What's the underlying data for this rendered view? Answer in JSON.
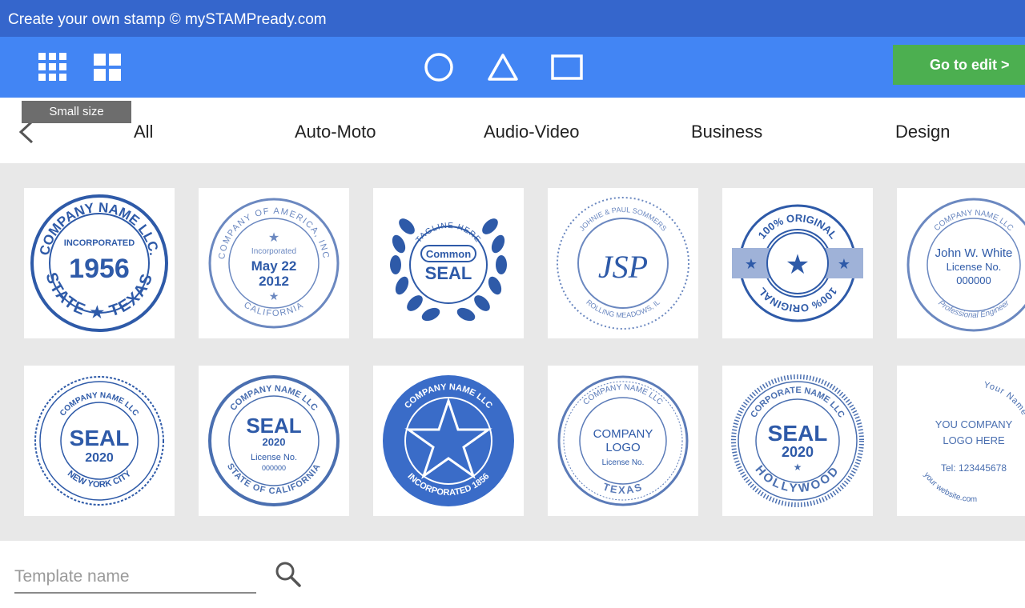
{
  "app": {
    "title": "Create your own stamp © mySTAMPready.com"
  },
  "toolbar": {
    "icons": [
      "large-grid-icon",
      "small-grid-icon",
      "circle-shape-icon",
      "triangle-shape-icon",
      "rectangle-shape-icon"
    ],
    "edit_label": "Go to edit  >"
  },
  "tooltip": {
    "text": "Small size"
  },
  "categories": {
    "all": "All",
    "auto_moto": "Auto-Moto",
    "audio_video": "Audio-Video",
    "business": "Business",
    "design": "Design"
  },
  "stamps": {
    "s1": {
      "top": "COMPANY NAME LLC.",
      "mid": "INCORPORATED",
      "year": "1956",
      "bottom": "STATE ★ TEXAS"
    },
    "s2": {
      "top": "COMPANY OF AMERICA, INC",
      "mid": "Incorporated",
      "date1": "May 22",
      "date2": "2012",
      "bottom": "CALIFORNIA"
    },
    "s3": {
      "top": "TAGLINE HERE",
      "line1": "Common",
      "line2": "SEAL"
    },
    "s4": {
      "top": "JOHNIE & PAUL SOMMERS",
      "mono": "JSP",
      "bottom": "ROLLING MEADOWS, IL"
    },
    "s5": {
      "top": "100% ORIGINAL",
      "bottom": "100% ORIGINAL"
    },
    "s6": {
      "top": "COMPANY NAME LLC",
      "name": "John W. White",
      "lic": "License No.",
      "num": "000000",
      "bottom": "Professional Engineer"
    },
    "s7": {
      "top": "COMPANY NAME LLC",
      "line1": "SEAL",
      "line2": "2020",
      "bottom": "NEW YORK CITY"
    },
    "s8": {
      "top": "COMPANY NAME LLC",
      "line1": "SEAL",
      "line2": "2020",
      "lic": "License No.",
      "num": "000000",
      "bottom": "STATE OF CALIFORNIA"
    },
    "s9": {
      "top": "COMPANY NAME LLC",
      "bottom": "INCORPORATED 1856"
    },
    "s10": {
      "top": "COMPANY NAME LLC",
      "line1": "COMPANY",
      "line2": "LOGO",
      "lic": "License No.",
      "bottom": "TEXAS"
    },
    "s11": {
      "top": "CORPORATE NAME LLC",
      "line1": "SEAL",
      "line2": "2020",
      "bottom": "HOLLYWOOD"
    },
    "s12": {
      "top": "Your Name",
      "line1": "YOU COMPANY",
      "line2": "LOGO HERE",
      "tel": "Tel: 123445678",
      "side": "your website.com"
    }
  },
  "search": {
    "placeholder": "Template name"
  },
  "colors": {
    "title_bar": "#3566cc",
    "toolbar": "#4285f4",
    "edit_button": "#4caf50",
    "stamp_blue": "#2e5aa8"
  }
}
